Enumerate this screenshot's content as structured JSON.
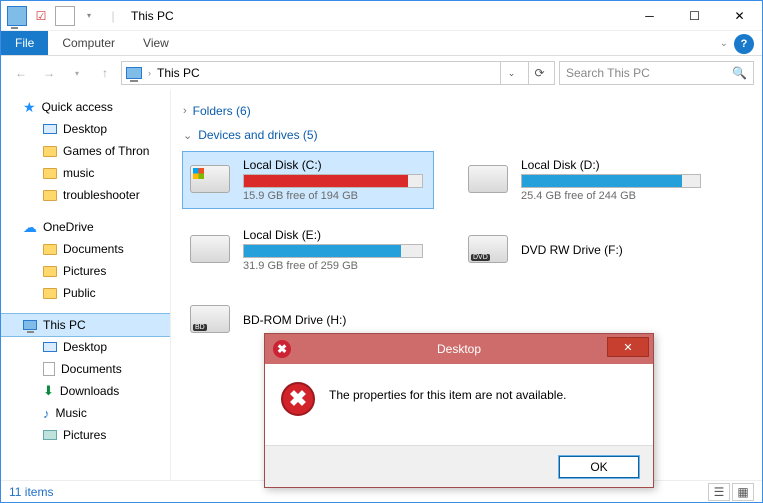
{
  "window": {
    "title": "This PC"
  },
  "ribbon": {
    "file": "File",
    "computer": "Computer",
    "view": "View"
  },
  "address": {
    "location": "This PC"
  },
  "search": {
    "placeholder": "Search This PC"
  },
  "sidebar": {
    "quick_access": "Quick access",
    "qa_items": [
      "Desktop",
      "Games of Thron",
      "music",
      "troubleshooter"
    ],
    "onedrive": "OneDrive",
    "od_items": [
      "Documents",
      "Pictures",
      "Public"
    ],
    "thispc": "This PC",
    "pc_items": [
      "Desktop",
      "Documents",
      "Downloads",
      "Music",
      "Pictures"
    ]
  },
  "groups": {
    "folders": "Folders (6)",
    "drives": "Devices and drives (5)"
  },
  "drives": [
    {
      "name": "Local Disk (C:)",
      "free": "15.9 GB free of 194 GB",
      "fill_pct": 92,
      "fill_color": "red",
      "icon": "win",
      "selected": true
    },
    {
      "name": "Local Disk (D:)",
      "free": "25.4 GB free of 244 GB",
      "fill_pct": 90,
      "fill_color": "blue",
      "icon": "disk"
    },
    {
      "name": "Local Disk (E:)",
      "free": "31.9 GB free of 259 GB",
      "fill_pct": 88,
      "fill_color": "blue",
      "icon": "disk"
    },
    {
      "name": "DVD RW Drive (F:)",
      "free": "",
      "fill_pct": 0,
      "fill_color": "",
      "icon": "dvd"
    },
    {
      "name": "BD-ROM Drive (H:)",
      "free": "",
      "fill_pct": 0,
      "fill_color": "",
      "icon": "bd"
    }
  ],
  "status": {
    "items": "11 items"
  },
  "dialog": {
    "title": "Desktop",
    "message": "The properties for this item are not available.",
    "ok": "OK"
  }
}
